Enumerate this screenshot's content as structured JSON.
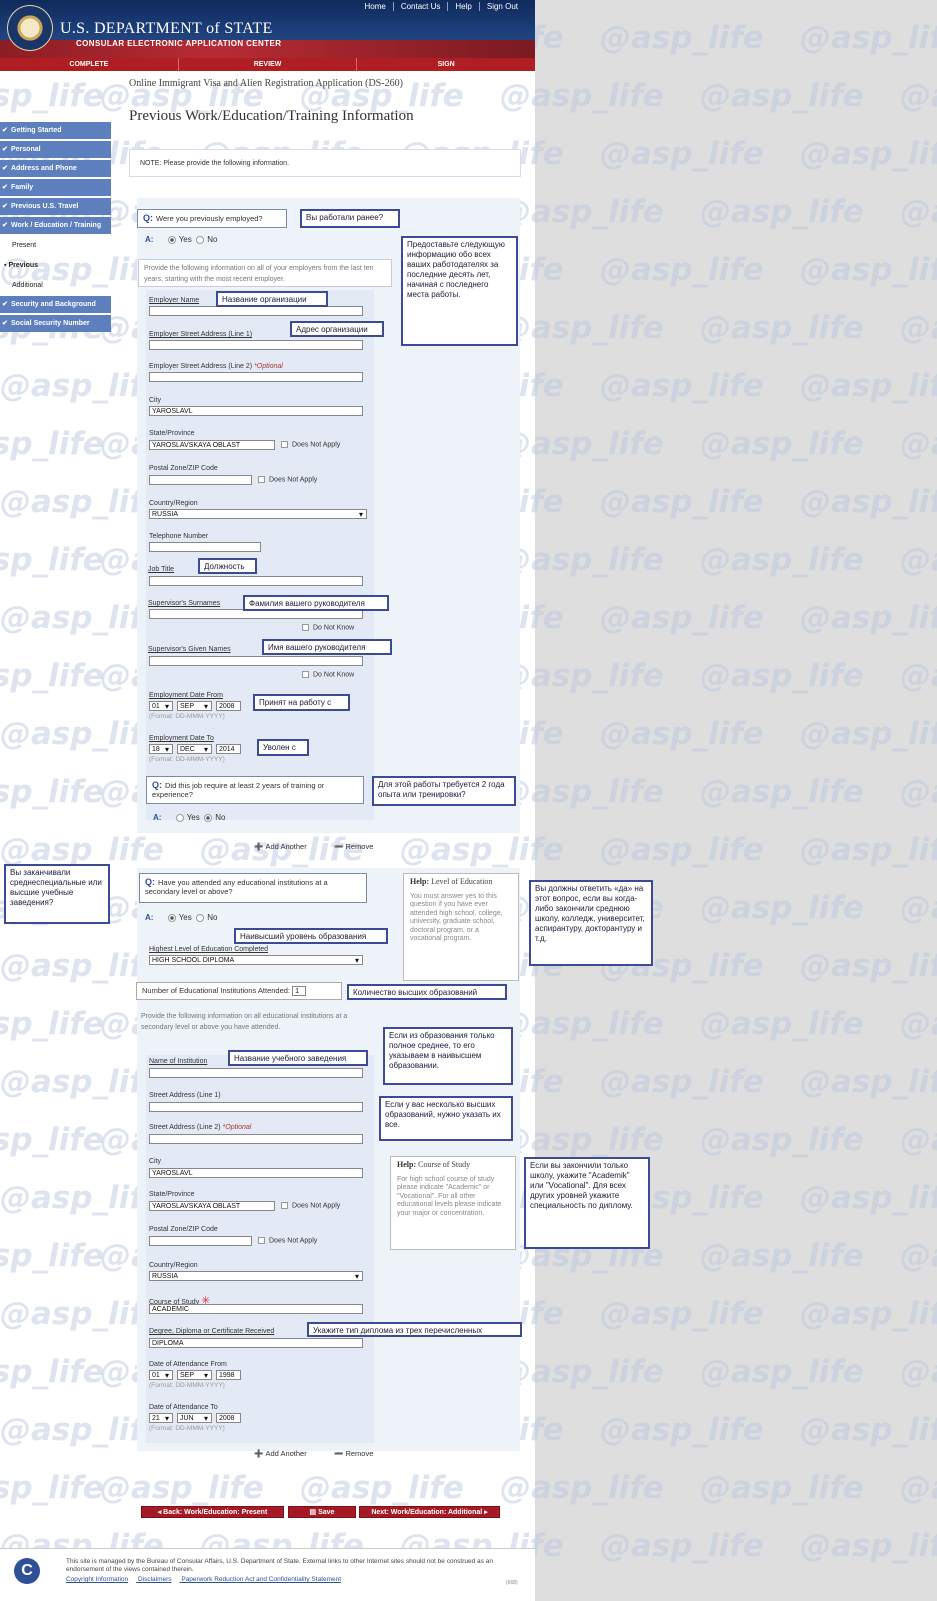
{
  "header": {
    "dept_title": "U.S. DEPARTMENT of STATE",
    "dept_subtitle": "CONSULAR ELECTRONIC APPLICATION CENTER",
    "top_links": [
      "Home",
      "Contact Us",
      "Help",
      "Sign Out"
    ],
    "steps": [
      "COMPLETE",
      "REVIEW",
      "SIGN"
    ]
  },
  "app_title": "Online Immigrant Visa and Alien Registration Application (DS-260)",
  "page_title": "Previous Work/Education/Training Information",
  "note": "NOTE: Please provide the following information.",
  "sidebar": {
    "items": [
      "Getting Started",
      "Personal",
      "Address and Phone",
      "Family",
      "Previous U.S. Travel",
      "Work / Education / Training"
    ],
    "sub_items": [
      "Present",
      "Previous",
      "Additional"
    ],
    "items2": [
      "Security and Background",
      "Social Security Number"
    ]
  },
  "employment": {
    "q_label": "Q:",
    "question": "Were you previously employed?",
    "a_label": "A:",
    "yes": "Yes",
    "no": "No",
    "instruction": "Provide the following information on all of your employers from the last ten years, starting with the most recent employer.",
    "employer_name_label": "Employer Name",
    "street1_label": "Employer Street Address (Line 1)",
    "street2_label": "Employer Street Address (Line 2)",
    "optional": "*Optional",
    "city_label": "City",
    "city_value": "YAROSLAVL",
    "state_label": "State/Province",
    "state_value": "YAROSLAVSKAYA OBLAST",
    "does_not_apply": "Does Not Apply",
    "zip_label": "Postal Zone/ZIP Code",
    "country_label": "Country/Region",
    "country_value": "RUSSIA",
    "phone_label": "Telephone Number",
    "job_title_label": "Job Title",
    "sup_surname_label": "Supervisor's Surnames",
    "do_not_know": "Do Not Know",
    "sup_given_label": "Supervisor's Given Names",
    "date_from_label": "Employment Date From",
    "date_from": {
      "day": "01",
      "month": "SEP",
      "year": "2008"
    },
    "date_to_label": "Employment Date To",
    "date_to": {
      "day": "18",
      "month": "DEC",
      "year": "2014"
    },
    "format": "(Format: DD-MMM-YYYY)",
    "q2": "Did this job require at least 2 years of training or experience?",
    "add_another": "Add Another",
    "remove": "Remove"
  },
  "education": {
    "question": "Have you attended any educational institutions at a secondary level or above?",
    "highest_label": "Highest Level of Education Completed",
    "highest_value": "HIGH SCHOOL DIPLOMA",
    "num_label": "Number of Educational Institutions Attended:",
    "num_value": "1",
    "instruction": "Provide the following information on all educational institutions at a secondary level or above you have attended.",
    "name_label": "Name of Institution",
    "street1_label": "Street Address (Line 1)",
    "street2_label": "Street Address (Line 2)",
    "city_value": "YAROSLAVL",
    "state_value": "YAROSLAVSKAYA OBLAST",
    "country_value": "RUSSIA",
    "course_label": "Course of Study",
    "course_value": "ACADEMIC",
    "degree_label": "Degree, Diploma or Certificate Received",
    "degree_value": "DIPLOMA",
    "att_from_label": "Date of Attendance From",
    "att_from": {
      "day": "01",
      "month": "SEP",
      "year": "1998"
    },
    "att_to_label": "Date of Attendance To",
    "att_to": {
      "day": "21",
      "month": "JUN",
      "year": "2008"
    }
  },
  "help": {
    "edu_title": "Help:",
    "edu_subject": "Level of Education",
    "edu_text": "You must answer yes to this question if you have ever attended high school, college, university, graduate school, doctoral program, or a vocational program.",
    "course_title": "Help:",
    "course_subject": "Course of Study",
    "course_text": "For high school course of study please indicate \"Academic\" or \"Vocational\". For all other educational levels please indicate your major or concentration."
  },
  "annotations": {
    "worked": "Вы работали ранее?",
    "provide_info": "Предоставьте следующую информацию обо всех ваших работодателях за последние десять лет, начиная с последнего места работы.",
    "org_name": "Название организации",
    "org_address": "Адрес организации",
    "job_title": "Должность",
    "sup_surname": "Фамилия вашего руководителя",
    "sup_given": "Имя вашего руководителя",
    "hired": "Принят на работу с",
    "fired": "Уволен с",
    "two_years": "Для этой работы требуется 2 года опыта или тренировки?",
    "finished": "Вы заканчивали среднеспециальные или высшие учебные заведения?",
    "answer_yes": "Вы должны ответить «да» на этот вопрос, если вы когда-либо закончили среднюю школу, колледж, университет, аспирантуру, докторантуру и т.д.",
    "highest_level": "Наивысший уровень образования",
    "count_higher": "Количество высших образований",
    "inst_name": "Название учебного заведения",
    "only_secondary": "Если из образования только полное среднее, то его указываем в наивысшем образовании.",
    "several_higher": "Если у вас несколько высших образований, нужно указать их все.",
    "course_hint": "Если вы закончили только школу, укажите \"Academik\" или \"Vocational\". Для всех других уровней укажите специальность по диплому.",
    "diploma_type": "Укажите тип диплома из трех перечисленных"
  },
  "buttons": {
    "back": "Back: Work/Education: Present",
    "save": "Save",
    "next": "Next: Work/Education: Additional"
  },
  "footer": {
    "text": "This site is managed by the Bureau of Consular Affairs, U.S. Department of State. External links to other Internet sites should not be construed as an endorsement of the views contained therein.",
    "links": [
      "Copyright Information",
      "Disclaimers",
      "Paperwork Reduction Act and Confidentiality Statement"
    ],
    "version": "(668)"
  },
  "watermark": "@asp_life"
}
